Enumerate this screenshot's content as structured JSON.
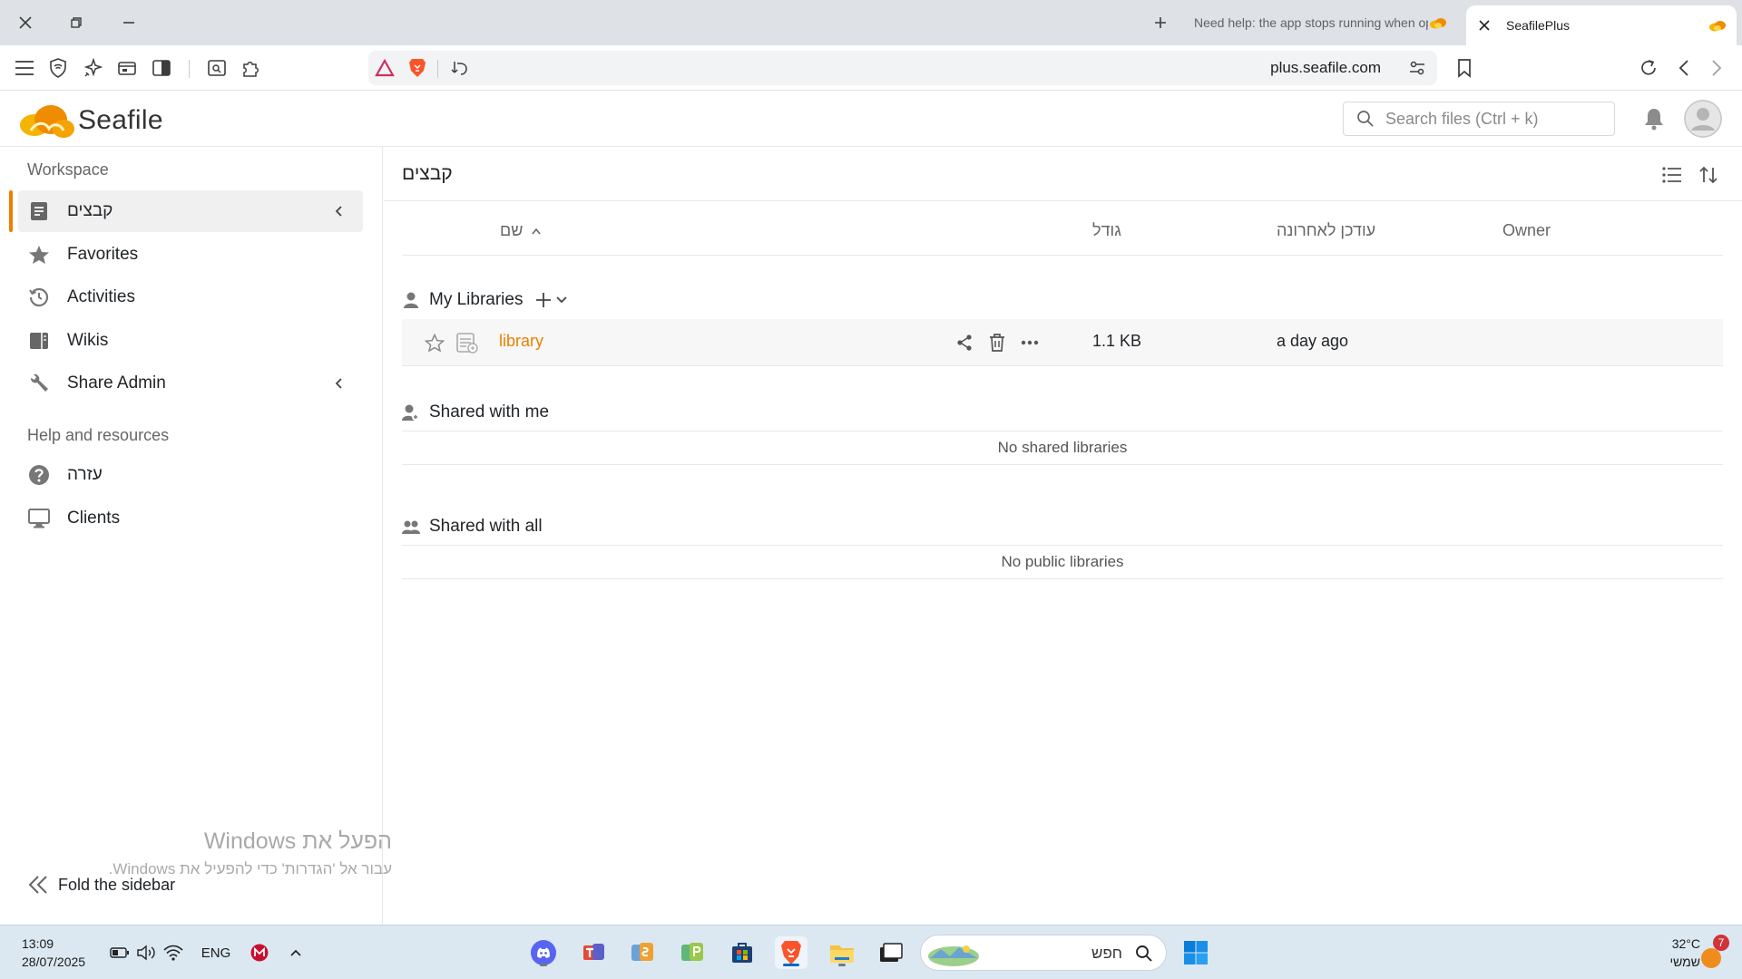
{
  "browser": {
    "tabs": [
      {
        "title": "Need help: the app stops running when opening a library",
        "active": false
      },
      {
        "title": "SeafilePlus",
        "active": true
      }
    ],
    "url": "plus.seafile.com"
  },
  "header": {
    "logo_text": "Seafile",
    "search_placeholder": "Search files (Ctrl + k)"
  },
  "sidebar": {
    "workspace_heading": "Workspace",
    "items": [
      {
        "label": "קבצים",
        "icon": "files-icon",
        "active": true,
        "has_submenu": true
      },
      {
        "label": "Favorites",
        "icon": "star-icon"
      },
      {
        "label": "Activities",
        "icon": "history-icon"
      },
      {
        "label": "Wikis",
        "icon": "wiki-icon"
      },
      {
        "label": "Share Admin",
        "icon": "wrench-icon",
        "has_submenu": true
      }
    ],
    "help_heading": "Help and resources",
    "help_items": [
      {
        "label": "עזרה",
        "icon": "help-icon"
      },
      {
        "label": "Clients",
        "icon": "monitor-icon"
      }
    ],
    "fold_label": "Fold the sidebar"
  },
  "main": {
    "path_title": "קבצים",
    "columns": {
      "name": "שם",
      "size": "גודל",
      "modified": "עודכן לאחרונה",
      "owner": "Owner"
    },
    "sections": {
      "my_libraries": "My Libraries",
      "shared_with_me": "Shared with me",
      "shared_with_all": "Shared with all"
    },
    "libraries": [
      {
        "name": "library",
        "size": "1.1 KB",
        "modified": "a day ago",
        "owner": ""
      }
    ],
    "empty_shared": "No shared libraries",
    "empty_public": "No public libraries"
  },
  "watermark": {
    "line1": "הפעל את Windows",
    "line2": "עבור אל 'הגדרות' כדי להפעיל את Windows."
  },
  "taskbar": {
    "time": "13:09",
    "date": "28/07/2025",
    "language": "ENG",
    "search_text": "חפש",
    "temperature": "32°C",
    "weather": "שמשי",
    "weather_badge": "7"
  },
  "colors": {
    "accent": "#ec8000",
    "taskbar": "#dbe8f1",
    "tabstrip": "#dee1e6"
  }
}
